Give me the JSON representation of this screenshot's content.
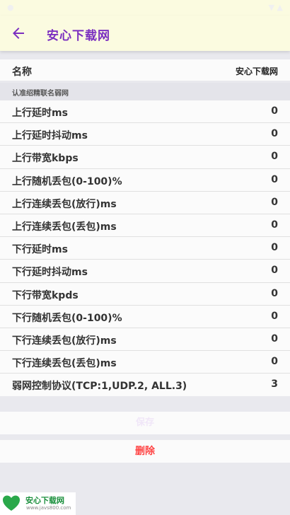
{
  "app_bar": {
    "title": "安心下载网"
  },
  "name_row": {
    "label": "名称",
    "value": "安心下载网"
  },
  "section_header": "认准绍精联名弱网",
  "params": [
    {
      "label": "上行延时ms",
      "value": "0"
    },
    {
      "label": "上行延时抖动ms",
      "value": "0"
    },
    {
      "label": "上行带宽kbps",
      "value": "0"
    },
    {
      "label": "上行随机丢包(0-100)%",
      "value": "0"
    },
    {
      "label": "上行连续丢包(放行)ms",
      "value": "0"
    },
    {
      "label": "上行连续丢包(丢包)ms",
      "value": "0"
    },
    {
      "label": "下行延时ms",
      "value": "0"
    },
    {
      "label": "下行延时抖动ms",
      "value": "0"
    },
    {
      "label": "下行带宽kpds",
      "value": "0"
    },
    {
      "label": "下行随机丢包(0-100)%",
      "value": "0"
    },
    {
      "label": "下行连续丢包(放行)ms",
      "value": "0"
    },
    {
      "label": "下行连续丢包(丢包)ms",
      "value": "0"
    },
    {
      "label": "弱网控制协议(TCP:1,UDP.2, ALL.3)",
      "value": "3"
    }
  ],
  "save_label": "保存",
  "delete_label": "删除",
  "watermark": {
    "brand": "安心下载网",
    "site": "www.javs800.com"
  },
  "colors": {
    "accent": "#7b2fc0",
    "app_bar_bg": "#fbfbe0",
    "delete": "#ff4444",
    "watermark_green": "#1a8f3c"
  }
}
